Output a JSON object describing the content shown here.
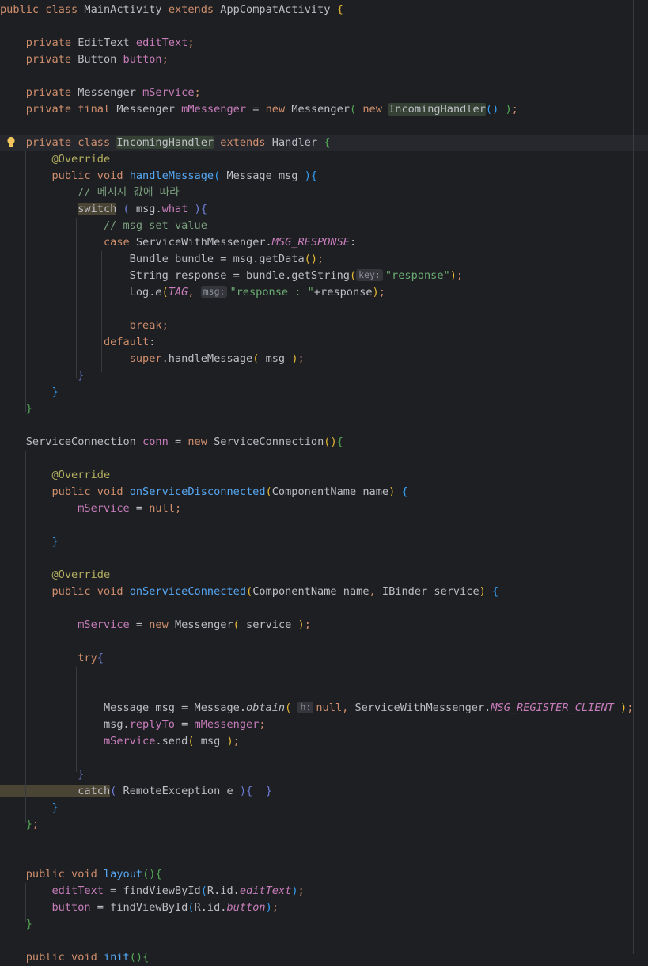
{
  "editor": {
    "lines": [
      [
        [
          "kw",
          "public class "
        ],
        [
          "",
          "MainActivity "
        ],
        [
          "kw",
          "extends "
        ],
        [
          "",
          "AppCompatActivity "
        ],
        [
          "b1",
          "{"
        ]
      ],
      [],
      [
        [
          "kw",
          "    private "
        ],
        [
          "",
          "EditText "
        ],
        [
          "fld",
          "editText"
        ],
        [
          "kw",
          ";"
        ]
      ],
      [
        [
          "kw",
          "    private "
        ],
        [
          "",
          "Button "
        ],
        [
          "fld",
          "button"
        ],
        [
          "kw",
          ";"
        ]
      ],
      [],
      [
        [
          "kw",
          "    private "
        ],
        [
          "",
          "Messenger "
        ],
        [
          "fld",
          "mService"
        ],
        [
          "kw",
          ";"
        ]
      ],
      [
        [
          "kw",
          "    private final "
        ],
        [
          "",
          "Messenger "
        ],
        [
          "fld",
          "mMessenger"
        ],
        [
          "",
          " = "
        ],
        [
          "kw",
          "new "
        ],
        [
          "",
          "Messenger"
        ],
        [
          "b2",
          "( "
        ],
        [
          "kw",
          "new "
        ],
        [
          "hl",
          "IncomingHandler"
        ],
        [
          "b3",
          "()"
        ],
        [
          "b2",
          " )"
        ],
        [
          "kw",
          ";"
        ]
      ],
      [],
      [
        [
          "kw",
          "    private class "
        ],
        [
          "hl",
          "IncomingHandler"
        ],
        [
          "kw",
          " extends "
        ],
        [
          "",
          "Handler "
        ],
        [
          "b2",
          "{"
        ]
      ],
      [
        [
          "ann",
          "        @Override"
        ]
      ],
      [
        [
          "kw",
          "        public void "
        ],
        [
          "fn",
          "handleMessage"
        ],
        [
          "b3",
          "( "
        ],
        [
          "",
          "Message msg "
        ],
        [
          "b3",
          ")"
        ],
        [
          "b3",
          "{"
        ]
      ],
      [
        [
          "cmt",
          "            // 메시지 값에 따라"
        ]
      ],
      [
        [
          "",
          "            "
        ],
        [
          "kwhl",
          "switch"
        ],
        [
          "",
          " "
        ],
        [
          "b4",
          "( "
        ],
        [
          "",
          "msg."
        ],
        [
          "fld",
          "what"
        ],
        [
          "b4",
          " )"
        ],
        [
          "b4",
          "{"
        ]
      ],
      [
        [
          "cmt",
          "                // msg set value"
        ]
      ],
      [
        [
          "kw",
          "                case "
        ],
        [
          "",
          "ServiceWithMessenger."
        ],
        [
          "stf",
          "MSG_RESPONSE"
        ],
        [
          "",
          ":"
        ]
      ],
      [
        [
          "",
          "                    Bundle bundle = msg.getData"
        ],
        [
          "b1",
          "()"
        ],
        [
          "kw",
          ";"
        ]
      ],
      [
        [
          "",
          "                    String response = bundle.getString"
        ],
        [
          "b1",
          "("
        ],
        [
          "hint",
          "key:"
        ],
        [
          "str",
          "\"response\""
        ],
        [
          "b1",
          ")"
        ],
        [
          "kw",
          ";"
        ]
      ],
      [
        [
          "",
          "                    Log."
        ],
        [
          "sfn",
          "e"
        ],
        [
          "b1",
          "("
        ],
        [
          "stf",
          "TAG"
        ],
        [
          "kw",
          ", "
        ],
        [
          "hint",
          "msg:"
        ],
        [
          "str",
          "\"response : \""
        ],
        [
          "",
          "+response"
        ],
        [
          "b1",
          ")"
        ],
        [
          "kw",
          ";"
        ]
      ],
      [],
      [
        [
          "kw",
          "                    break;"
        ]
      ],
      [
        [
          "kw",
          "                default"
        ],
        [
          "",
          ":"
        ]
      ],
      [
        [
          "kw",
          "                    super"
        ],
        [
          "",
          ".handleMessage"
        ],
        [
          "b1",
          "( "
        ],
        [
          "",
          "msg "
        ],
        [
          "b1",
          ")"
        ],
        [
          "kw",
          ";"
        ]
      ],
      [
        [
          "b4",
          "            }"
        ]
      ],
      [
        [
          "b3",
          "        }"
        ]
      ],
      [
        [
          "b2",
          "    }"
        ]
      ],
      [],
      [
        [
          "",
          "    ServiceConnection "
        ],
        [
          "fld",
          "conn"
        ],
        [
          "",
          " = "
        ],
        [
          "kw",
          "new "
        ],
        [
          "",
          "ServiceConnection"
        ],
        [
          "b1",
          "()"
        ],
        [
          "b2",
          "{"
        ]
      ],
      [],
      [
        [
          "ann",
          "        @Override"
        ]
      ],
      [
        [
          "kw",
          "        public void "
        ],
        [
          "fn",
          "onServiceDisconnected"
        ],
        [
          "b1",
          "("
        ],
        [
          "",
          "ComponentName name"
        ],
        [
          "b1",
          ") "
        ],
        [
          "b3",
          "{"
        ]
      ],
      [
        [
          "fld",
          "            mService"
        ],
        [
          "",
          " = "
        ],
        [
          "kw",
          "null;"
        ]
      ],
      [],
      [
        [
          "b3",
          "        }"
        ]
      ],
      [],
      [
        [
          "ann",
          "        @Override"
        ]
      ],
      [
        [
          "kw",
          "        public void "
        ],
        [
          "fn",
          "onServiceConnected"
        ],
        [
          "b1",
          "("
        ],
        [
          "",
          "ComponentName name"
        ],
        [
          "kw",
          ", "
        ],
        [
          "",
          "IBinder service"
        ],
        [
          "b1",
          ") "
        ],
        [
          "b3",
          "{"
        ]
      ],
      [],
      [
        [
          "fld",
          "            mService"
        ],
        [
          "",
          " = "
        ],
        [
          "kw",
          "new "
        ],
        [
          "",
          "Messenger"
        ],
        [
          "b1",
          "( "
        ],
        [
          "",
          "service "
        ],
        [
          "b1",
          ")"
        ],
        [
          "kw",
          ";"
        ]
      ],
      [],
      [
        [
          "kw",
          "            try"
        ],
        [
          "b4",
          "{"
        ]
      ],
      [],
      [],
      [
        [
          "",
          "                Message msg = Message."
        ],
        [
          "sfn",
          "obtain"
        ],
        [
          "b1",
          "( "
        ],
        [
          "hint",
          "h:"
        ],
        [
          "kw",
          "null, "
        ],
        [
          "",
          "ServiceWithMessenger."
        ],
        [
          "stf",
          "MSG_REGISTER_CLIENT"
        ],
        [
          "b1",
          " )"
        ],
        [
          "kw",
          ";"
        ]
      ],
      [
        [
          "",
          "                msg."
        ],
        [
          "fld",
          "replyTo"
        ],
        [
          "",
          " = "
        ],
        [
          "fld",
          "mMessenger"
        ],
        [
          "kw",
          ";"
        ]
      ],
      [
        [
          "fld",
          "                mService"
        ],
        [
          "",
          ".send"
        ],
        [
          "b1",
          "( "
        ],
        [
          "",
          "msg "
        ],
        [
          "b1",
          ")"
        ],
        [
          "kw",
          ";"
        ]
      ],
      [],
      [
        [
          "b4",
          "            }"
        ]
      ],
      [
        [
          "kwhl",
          "            catch"
        ],
        [
          "b4",
          "( "
        ],
        [
          "",
          "RemoteException e "
        ],
        [
          "b4",
          ")"
        ],
        [
          "b4",
          "{  }"
        ]
      ],
      [
        [
          "b3",
          "        }"
        ]
      ],
      [
        [
          "b2",
          "    }"
        ],
        [
          "kw",
          ";"
        ]
      ],
      [],
      [],
      [
        [
          "kw",
          "    public void "
        ],
        [
          "fn",
          "layout"
        ],
        [
          "b2",
          "()"
        ],
        [
          "b2",
          "{"
        ]
      ],
      [
        [
          "fld",
          "        editText"
        ],
        [
          "",
          " = findViewById"
        ],
        [
          "b3",
          "("
        ],
        [
          "",
          "R.id."
        ],
        [
          "stf",
          "editText"
        ],
        [
          "b3",
          ")"
        ],
        [
          "kw",
          ";"
        ]
      ],
      [
        [
          "fld",
          "        button"
        ],
        [
          "",
          " = findViewById"
        ],
        [
          "b3",
          "("
        ],
        [
          "",
          "R.id."
        ],
        [
          "stf",
          "button"
        ],
        [
          "b3",
          ")"
        ],
        [
          "kw",
          ";"
        ]
      ],
      [
        [
          "b2",
          "    }"
        ]
      ],
      [],
      [
        [
          "kw",
          "    public void "
        ],
        [
          "fn",
          "init"
        ],
        [
          "b2",
          "()"
        ],
        [
          "b2",
          "{"
        ]
      ]
    ]
  },
  "gutter": {
    "intention_icon": "lightbulb-icon"
  }
}
